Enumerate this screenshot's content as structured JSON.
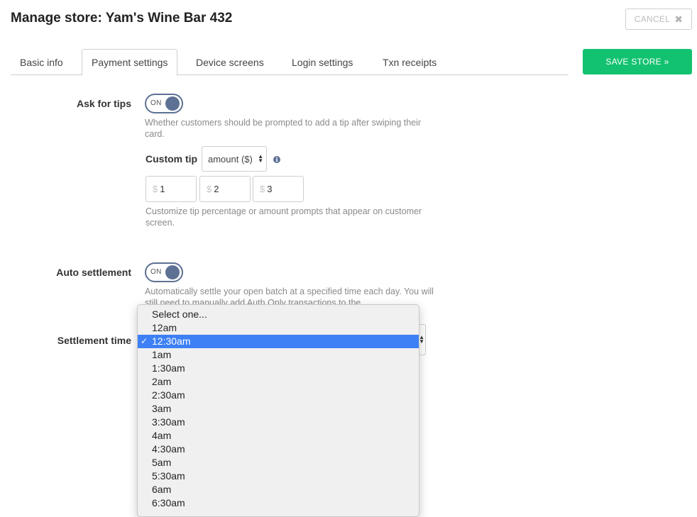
{
  "header": {
    "title": "Manage store: Yam's Wine Bar 432",
    "cancel_label": "CANCEL",
    "save_label": "SAVE STORE »"
  },
  "tabs": [
    {
      "label": "Basic info",
      "active": false
    },
    {
      "label": "Payment settings",
      "active": true
    },
    {
      "label": "Device screens",
      "active": false
    },
    {
      "label": "Login settings",
      "active": false
    },
    {
      "label": "Txn receipts",
      "active": false
    }
  ],
  "tips": {
    "label": "Ask for tips",
    "toggle_label": "ON",
    "help": "Whether customers should be prompted to add a tip after swiping their card.",
    "custom_tip_label": "Custom tip",
    "custom_tip_mode": "amount ($)",
    "currency_symbol": "$",
    "values": [
      "1",
      "2",
      "3"
    ],
    "custom_help": "Customize tip percentage or amount prompts that appear on customer screen."
  },
  "settlement": {
    "label": "Auto settlement",
    "toggle_label": "ON",
    "help": "Automatically settle your open batch at a specified time each day. You will still need to manually add Auth Only transactions to the",
    "time_label": "Settlement time",
    "options": [
      "Select one...",
      "12am",
      "12:30am",
      "1am",
      "1:30am",
      "2am",
      "2:30am",
      "3am",
      "3:30am",
      "4am",
      "4:30am",
      "5am",
      "5:30am",
      "6am",
      "6:30am"
    ],
    "selected": "12:30am",
    "check_glyph": "✓"
  },
  "colors": {
    "accent_green": "#13c270",
    "toggle_blue": "#5d7194",
    "selection_blue": "#3d80f5"
  }
}
